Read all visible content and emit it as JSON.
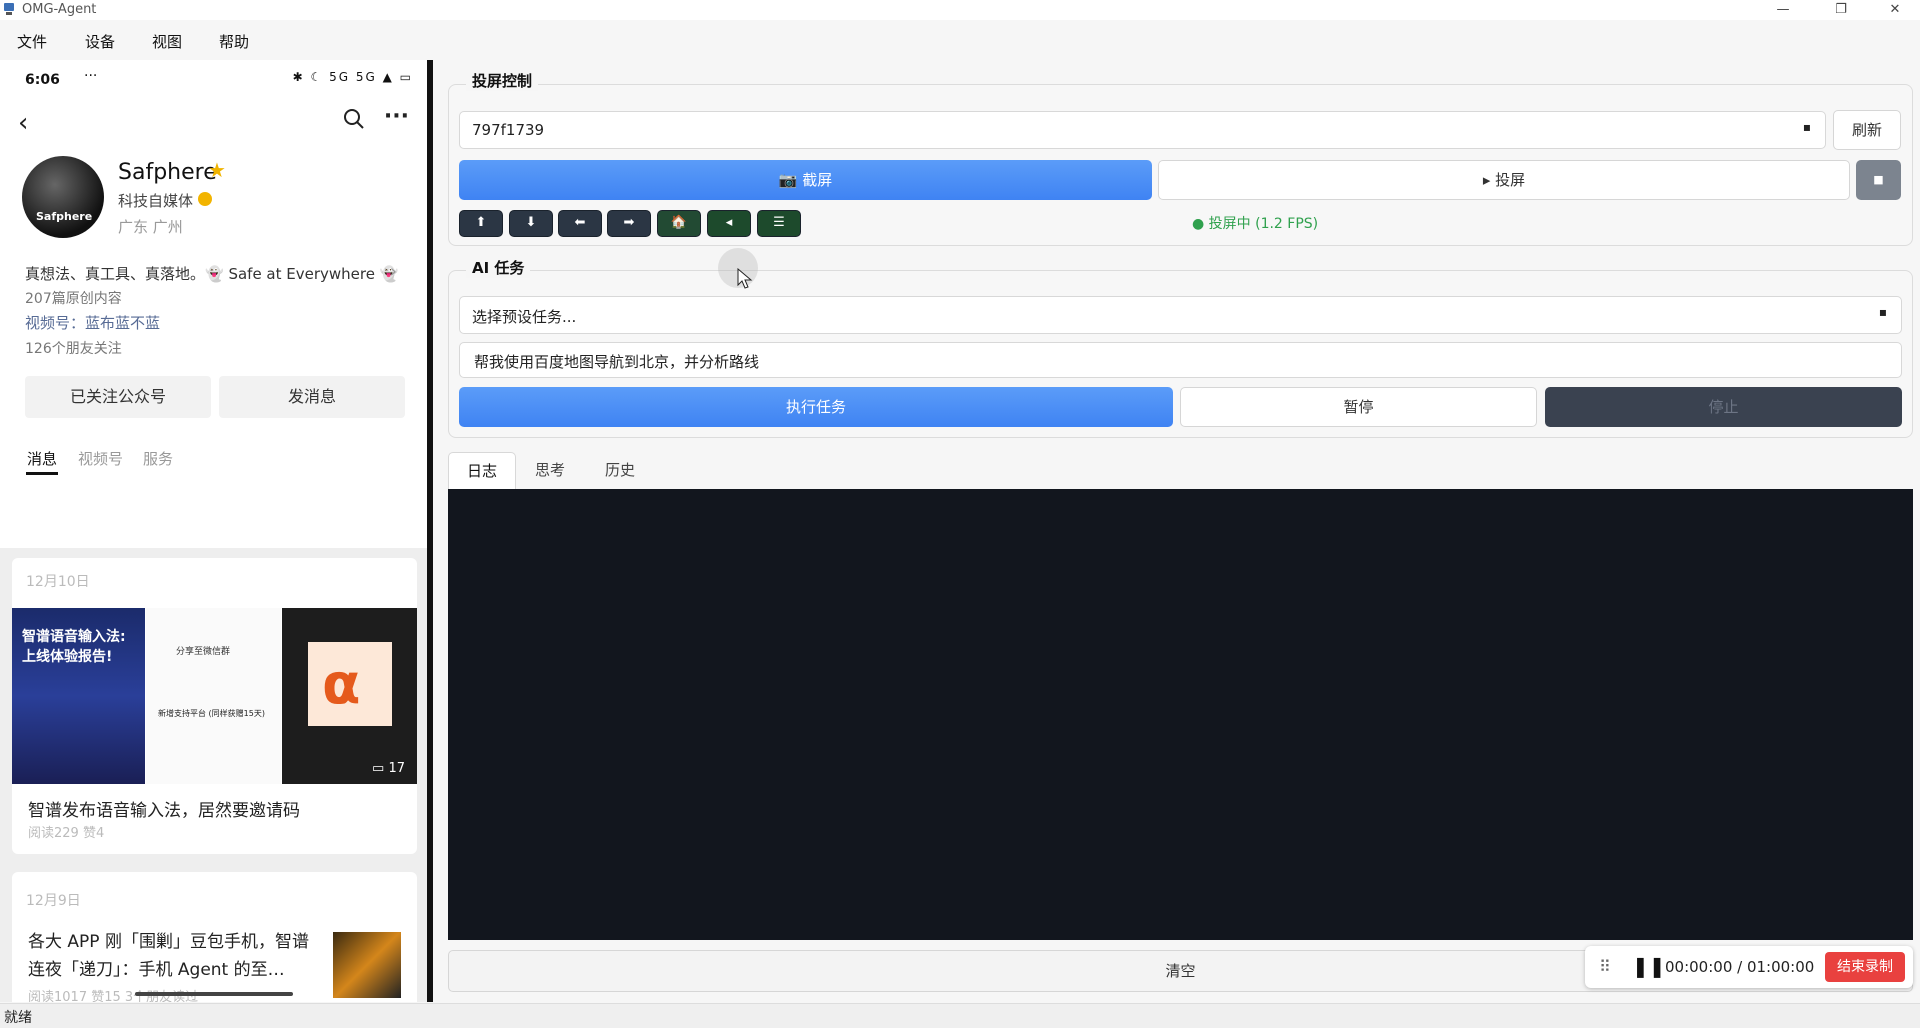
{
  "window": {
    "title": "OMG-Agent",
    "controls": {
      "minimize": "—",
      "restore": "❐",
      "close": "✕"
    }
  },
  "menu": [
    "文件",
    "设备",
    "视图",
    "帮助"
  ],
  "phone": {
    "status_time": "6:06",
    "status_dots": "···",
    "status_icons": "✱ ☾ 5G 5G ▲ ▭",
    "profile": {
      "name": "Safphere",
      "type": "科技自媒体",
      "location": "广东 广州",
      "bio": "真想法、真工具、真落地。👻 Safe at Everywhere 👻",
      "original_count": "207篇原创内容",
      "video_label": "视频号：蓝布蓝不蓝",
      "friends": "126个朋友关注",
      "btn_follow": "已关注公众号",
      "btn_message": "发消息",
      "tabs": [
        "消息",
        "视频号",
        "服务"
      ],
      "avatar_text": "Safphere"
    },
    "articles": [
      {
        "date": "12月10日",
        "title": "智谱发布语音输入法，居然要邀请码",
        "meta": "阅读229  赞4",
        "image_text_1": "智谱语音输入法:",
        "image_text_2": "上线体验报告!",
        "image2_line1": "分享至微信群",
        "image2_line2": "新增支持平台 (同样获赠15天)",
        "image_count": "17",
        "image3_letter": "α"
      },
      {
        "date": "12月9日",
        "title_line1": "各大 APP 刚「围剿」豆包手机，智谱",
        "title_line2": "连夜「递刀」：手机 Agent 的至…",
        "meta": "阅读1017  赞15  3个朋友读过"
      }
    ]
  },
  "control": {
    "group_title": "投屏控制",
    "device_id": "797f1739",
    "refresh": "刷新",
    "screenshot": "📷 截屏",
    "mirror": "▸ 投屏",
    "stop_mirror": "■",
    "nav_buttons": [
      "⬆",
      "⬇",
      "⬅",
      "➡",
      "🏠",
      "◂",
      "☰"
    ],
    "fps_status": "● 投屏中 (1.2 FPS)"
  },
  "task": {
    "group_title": "AI 任务",
    "preset_placeholder": "选择预设任务...",
    "task_input": "帮我使用百度地图导航到北京，并分析路线",
    "run": "执行任务",
    "pause": "暂停",
    "stop": "停止"
  },
  "tabs": [
    "日志",
    "思考",
    "历史"
  ],
  "clear": "清空",
  "recorder": {
    "timer": "00:00:00 / 01:00:00",
    "stop": "结束录制",
    "grip": "⠿",
    "pause": "❚❚"
  },
  "statusbar": "就绪",
  "colors": {
    "accent": "#4a8ef5",
    "log_bg": "#12161e",
    "record_red": "#e9413f",
    "fps_green": "#30a14e"
  }
}
